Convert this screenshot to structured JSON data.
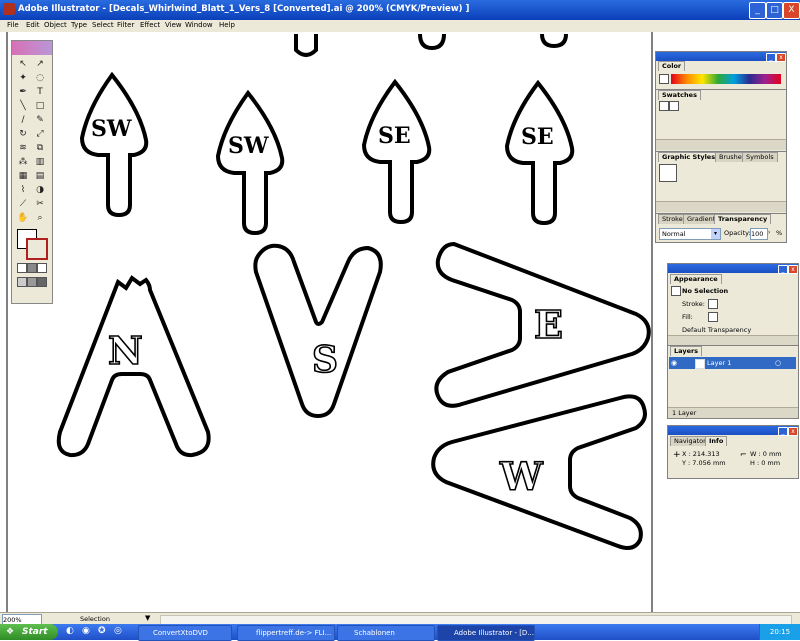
{
  "window": {
    "title": "Adobe Illustrator - [Decals_Whirlwind_Blatt_1_Vers_8 [Converted].ai @ 200% (CMYK/Preview) ]",
    "min": "_",
    "max": "□",
    "close": "X"
  },
  "menu": [
    "File",
    "Edit",
    "Object",
    "Type",
    "Select",
    "Filter",
    "Effect",
    "View",
    "Window",
    "Help"
  ],
  "decals": {
    "sw1": "SW",
    "sw2": "SW",
    "se1": "SE",
    "se2": "SE",
    "n": "N",
    "s": "S",
    "e": "E",
    "w": "W"
  },
  "color_panel": {
    "tab": "Color"
  },
  "swatches_panel": {
    "tab": "Swatches"
  },
  "styles_panel": {
    "tabs": [
      "Graphic Styles",
      "Brushes",
      "Symbols"
    ]
  },
  "stroke_panel": {
    "tabs": [
      "Stroke",
      "Gradient",
      "Transparency"
    ],
    "blend_mode": "Normal",
    "opacity_label": "Opacity:",
    "opacity_value": "100",
    "opacity_unit": "%"
  },
  "appearance_panel": {
    "tab": "Appearance",
    "selection": "No Selection",
    "stroke_label": "Stroke:",
    "fill_label": "Fill:",
    "default_transparency": "Default Transparency"
  },
  "layers_panel": {
    "tab": "Layers",
    "layer_name": "Layer 1",
    "footer": "1 Layer"
  },
  "info_panel": {
    "tabs": [
      "Navigator",
      "Info"
    ],
    "x": "X : 214.313",
    "y": "Y : 7.056 mm",
    "w": "W : 0 mm",
    "h": "H : 0 mm"
  },
  "status": {
    "zoom": "200%",
    "mode": "Selection"
  },
  "taskbar": {
    "start": "Start",
    "tasks": [
      "ConvertXtoDVD",
      "flippertreff.de-> FLI...",
      "Schablonen",
      "Adobe Illustrator - [D..."
    ],
    "clock": "20:15"
  },
  "colors": {
    "titlebar": "#0a3fb8",
    "panel_bg": "#ece9d8",
    "start_green": "#2f8d27",
    "close_red": "#d9472a"
  }
}
